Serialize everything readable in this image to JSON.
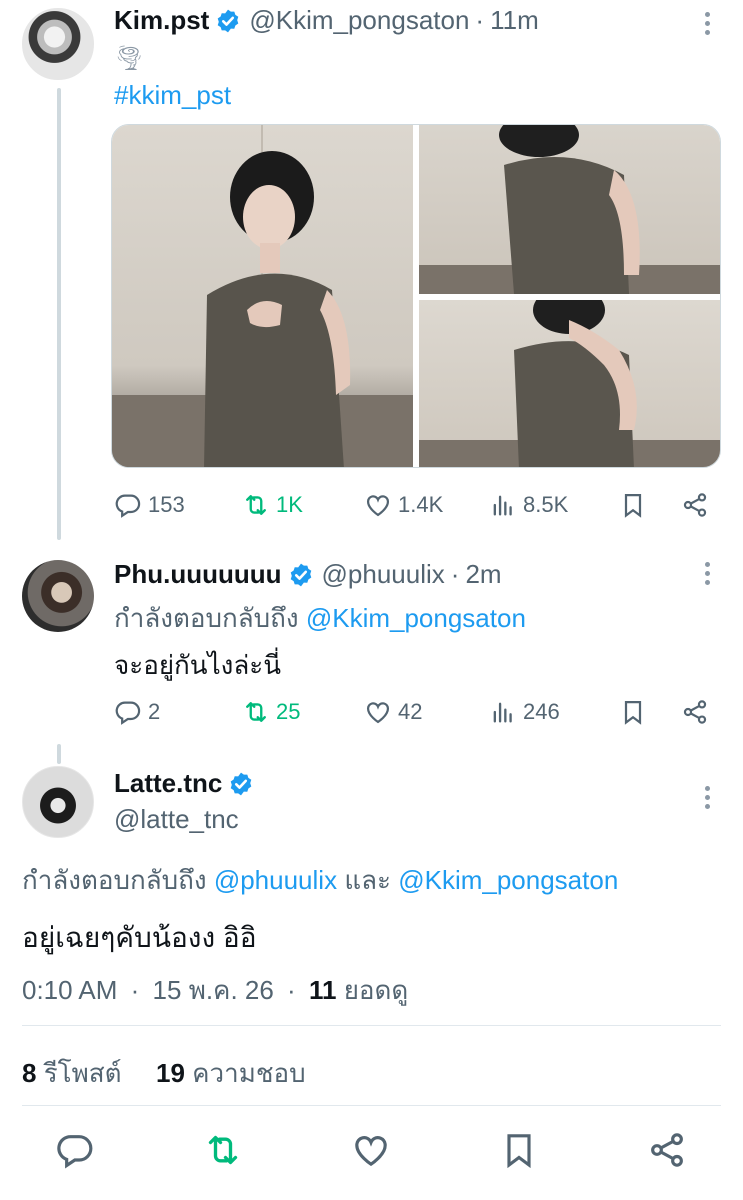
{
  "tweet1": {
    "name": "Kim.pst",
    "handle": "@Kkim_pongsaton",
    "time": "11m",
    "emoji": "🌪",
    "hashtag": "#kkim_pst",
    "actions": {
      "replies": "153",
      "retweets": "1K",
      "likes": "1.4K",
      "views": "8.5K"
    }
  },
  "tweet2": {
    "name": "Phu.uuuuuuu",
    "handle": "@phuuulix",
    "time": "2m",
    "reply_prefix": "กำลังตอบกลับถึง",
    "reply_to": "@Kkim_pongsaton",
    "text": "จะอยู่กันไงล่ะนี่",
    "actions": {
      "replies": "2",
      "retweets": "25",
      "likes": "42",
      "views": "246"
    }
  },
  "tweet3": {
    "name": "Latte.tnc",
    "handle": "@latte_tnc",
    "reply_prefix": "กำลังตอบกลับถึง",
    "reply_to_1": "@phuuulix",
    "conjunction": "และ",
    "reply_to_2": "@Kkim_pongsaton",
    "text": "อยู่เฉยๆคับน้องง อิอิ",
    "time": "0:10 AM",
    "date": "15 พ.ค. 26",
    "views_count": "11",
    "views_label": "ยอดดู",
    "reposts_count": "8",
    "reposts_label": "รีโพสต์",
    "likes_count": "19",
    "likes_label": "ความชอบ"
  },
  "colors": {
    "accent": "#1d9bf0",
    "retweet": "#00ba7c",
    "muted": "#536471"
  },
  "icons": [
    "verified-badge-icon",
    "reply-icon",
    "retweet-icon",
    "like-icon",
    "views-icon",
    "bookmark-icon",
    "share-icon",
    "more-icon"
  ]
}
